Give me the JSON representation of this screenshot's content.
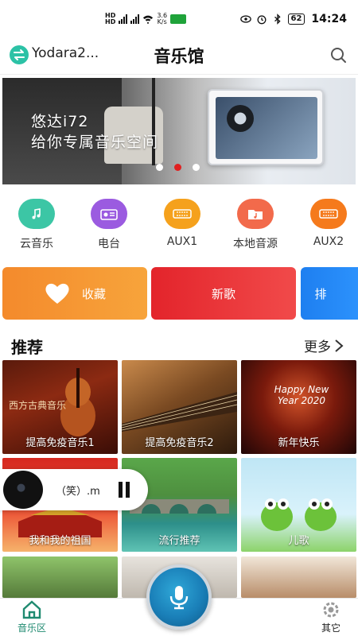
{
  "status_bar": {
    "net_speed": "3.6",
    "net_unit": "K/s",
    "battery": "62",
    "time": "14:24"
  },
  "header": {
    "device_name": "Yodara2...",
    "title": "音乐馆"
  },
  "banner": {
    "line1": "悠达i72",
    "line2": "给你专属音乐空间",
    "active_slide": 2,
    "slide_count": 3
  },
  "quick_entries": [
    {
      "label": "云音乐",
      "icon": "music-note-icon",
      "color": "#3cc6a5"
    },
    {
      "label": "电台",
      "icon": "radio-icon",
      "color": "#9b5be0"
    },
    {
      "label": "AUX1",
      "icon": "aux-icon",
      "color": "#f5a11c"
    },
    {
      "label": "本地音源",
      "icon": "folder-music-icon",
      "color": "#f26a4b"
    },
    {
      "label": "AUX2",
      "icon": "aux-icon",
      "color": "#f57a1c"
    }
  ],
  "categories": [
    {
      "label": "收藏",
      "icon": "heart-icon"
    },
    {
      "label": "新歌"
    },
    {
      "label": "排"
    }
  ],
  "recommend": {
    "title": "推荐",
    "more": "更多",
    "items": [
      {
        "caption": "提高免疫音乐1",
        "art_text": "西方古典音乐"
      },
      {
        "caption": "提高免疫音乐2"
      },
      {
        "caption": "新年快乐",
        "art_text": "Happy New Year 2020"
      },
      {
        "caption": "我和我的祖国"
      },
      {
        "caption": "流行推荐"
      },
      {
        "caption": "儿歌"
      },
      {
        "caption": ""
      },
      {
        "caption": ""
      },
      {
        "caption": ""
      }
    ]
  },
  "player": {
    "title": "（笑）.m"
  },
  "bottom_nav": {
    "home": "音乐区",
    "other": "其它"
  }
}
